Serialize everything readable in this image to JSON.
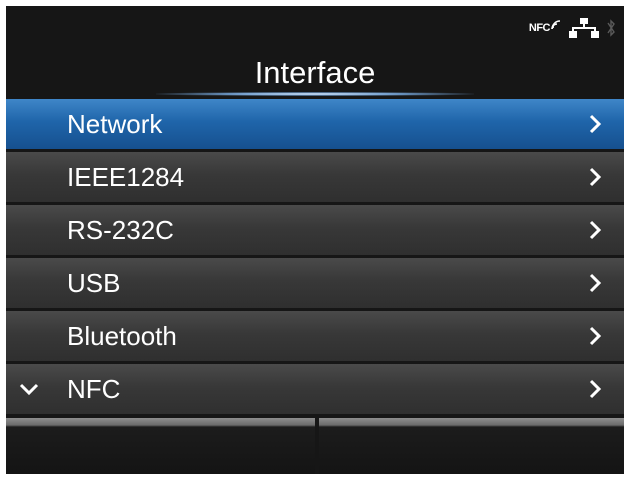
{
  "status_bar": {
    "nfc_label": "NFC",
    "icons": [
      "nfc-icon",
      "network-icon",
      "bluetooth-icon"
    ]
  },
  "header": {
    "title": "Interface"
  },
  "menu": {
    "selected_index": 0,
    "items": [
      {
        "label": "Network"
      },
      {
        "label": "IEEE1284"
      },
      {
        "label": "RS-232C"
      },
      {
        "label": "USB"
      },
      {
        "label": "Bluetooth"
      },
      {
        "label": "NFC"
      }
    ]
  },
  "softkeys": {
    "left_label": "",
    "right_label": ""
  },
  "colors": {
    "screen_background": "#161616",
    "selected_item": "#1f65aa",
    "item_background": "#383838",
    "text": "#ffffff"
  }
}
